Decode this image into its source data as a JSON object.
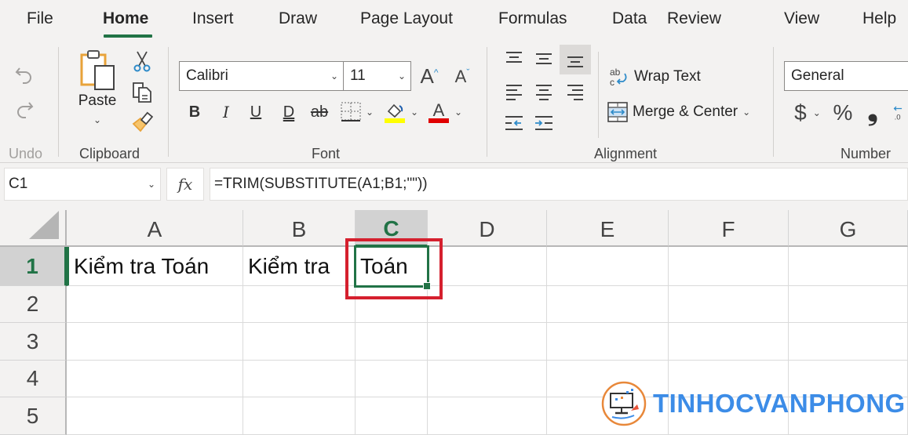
{
  "tabs": [
    {
      "label": "File",
      "active": false
    },
    {
      "label": "Home",
      "active": true
    },
    {
      "label": "Insert",
      "active": false
    },
    {
      "label": "Draw",
      "active": false
    },
    {
      "label": "Page Layout",
      "active": false
    },
    {
      "label": "Formulas",
      "active": false
    },
    {
      "label": "Data",
      "active": false
    },
    {
      "label": "Review",
      "active": false
    },
    {
      "label": "View",
      "active": false
    },
    {
      "label": "Help",
      "active": false
    }
  ],
  "ribbon": {
    "undo": {
      "group_label": "Undo",
      "undo_icon": "undo-icon",
      "redo_icon": "redo-icon"
    },
    "clipboard": {
      "group_label": "Clipboard",
      "paste_label": "Paste",
      "icons": [
        "paste-icon",
        "cut-icon",
        "copy-icon",
        "format-painter-icon"
      ]
    },
    "font": {
      "group_label": "Font",
      "font_name": "Calibri",
      "font_size": "11",
      "buttons": [
        "B",
        "I",
        "U",
        "D",
        "ab"
      ],
      "highlight_color": "#ffff00",
      "font_color": "#e00000"
    },
    "alignment": {
      "group_label": "Alignment",
      "wrap_text_label": "Wrap Text",
      "merge_center_label": "Merge & Center"
    },
    "number": {
      "group_label": "Number",
      "format": "General",
      "currency": "$",
      "percent": "%",
      "comma": "❟"
    }
  },
  "formula_bar": {
    "name_box": "C1",
    "fx_label": "fx",
    "formula": "=TRIM(SUBSTITUTE(A1;B1;\"\"))"
  },
  "sheet": {
    "columns": [
      "A",
      "B",
      "C",
      "D",
      "E",
      "F",
      "G"
    ],
    "rows": [
      "1",
      "2",
      "3",
      "4",
      "5"
    ],
    "selected_cell": "C1",
    "cells": {
      "A1": "Kiểm tra Toán",
      "B1": "Kiểm tra",
      "C1": "Toán"
    }
  },
  "colors": {
    "accent": "#217346",
    "highlight_box": "#d5202e",
    "watermark": "#3c8ce7"
  },
  "watermark": {
    "text": "TINHOCVANPHONG"
  }
}
